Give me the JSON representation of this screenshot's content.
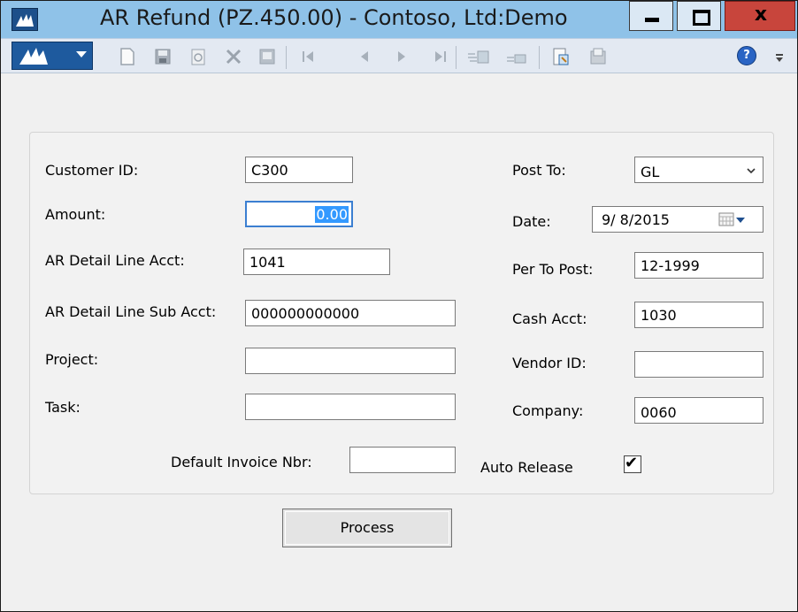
{
  "window": {
    "title": "AR Refund (PZ.450.00) - Contoso, Ltd:Demo",
    "close_glyph": "x",
    "help_glyph": "?"
  },
  "toolbar": {
    "icons": [
      "new-icon",
      "save-icon",
      "refresh-icon",
      "delete-icon",
      "copy-icon",
      "first-record-icon",
      "previous-record-icon",
      "next-record-icon",
      "last-record-icon",
      "insert-icon",
      "cut-icon",
      "attachment-icon",
      "note-icon",
      "help-icon"
    ]
  },
  "form": {
    "customer_id": {
      "label": "Customer ID:",
      "value": "C300"
    },
    "amount": {
      "label": "Amount:",
      "value": "0.00"
    },
    "ar_detail_line_acct": {
      "label": "AR Detail Line Acct:",
      "value": "1041"
    },
    "ar_detail_line_sub_acct": {
      "label": "AR Detail Line Sub Acct:",
      "value": "000000000000"
    },
    "project": {
      "label": "Project:",
      "value": ""
    },
    "task": {
      "label": "Task:",
      "value": ""
    },
    "default_invoice_nbr": {
      "label": "Default Invoice Nbr:",
      "value": ""
    },
    "post_to": {
      "label": "Post To:",
      "value": "GL"
    },
    "date": {
      "label": "Date:",
      "value": "9/ 8/2015"
    },
    "per_to_post": {
      "label": "Per To Post:",
      "value": "12-1999"
    },
    "cash_acct": {
      "label": "Cash Acct:",
      "value": "1030"
    },
    "vendor_id": {
      "label": "Vendor ID:",
      "value": ""
    },
    "company": {
      "label": "Company:",
      "value": "0060"
    },
    "auto_release": {
      "label": "Auto Release",
      "checked": true,
      "mark": "✔"
    }
  },
  "actions": {
    "process_label": "Process"
  },
  "colors": {
    "titlebar": "#8fc2e8",
    "close_button": "#c8453c",
    "selection": "#3399ff",
    "focus_border": "#3b7fd1"
  }
}
